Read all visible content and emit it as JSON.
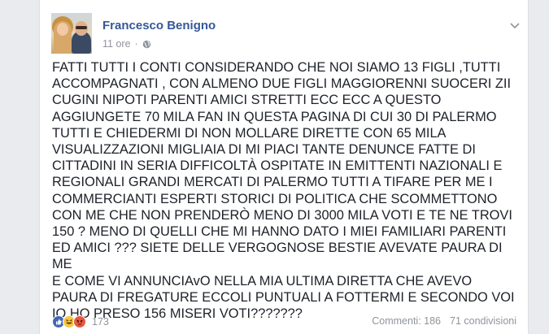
{
  "post": {
    "author": "Francesco Benigno",
    "time": "11 ore",
    "separator": "·",
    "privacy_icon": "globe-icon",
    "text": "FATTI TUTTI I CONTI CONSIDERANDO CHE NOI SIAMO 13 FIGLI ,TUTTI\nACCOMPAGNATI , CON ALMENO DUE FIGLI MAGGIORENNI SUOCERI ZII\nCUGINI NIPOTI PARENTI AMICI STRETTI ECC  ECC A QUESTO\nAGGIUNGETE 70 MILA FAN IN QUESTA PAGINA DI CUI 30 DI PALERMO\nTUTTI E CHIEDERMI DI NON MOLLARE DIRETTE CON 65 MILA\nVISUALIZZAZIONI MIGLIAIA DI MI PIACI TANTE DENUNCE FATTE DI\nCITTADINI IN SERIA DIFFICOLTÀ OSPITATE IN EMITTENTI NAZIONALI E\nREGIONALI GRANDI MERCATI DI PALERMO TUTTI A TIFARE PER ME I\nCOMMERCIANTI ESPERTI STORICI DI POLITICA CHE SCOMMETTONO\nCON ME CHE NON PRENDERÒ MENO DI 3000 MILA VOTI E TE NE TROVI\n150 ? MENO DI QUELLI CHE MI HANNO DATO I MIEI FAMILIARI PARENTI\nED AMICI ??? SIETE DELLE VERGOGNOSE BESTIE AVEVATE PAURA DI ME\nE COME VI ANNUNCIAvO NELLA MIA ULTIMA DIRETTA CHE AVEVO\nPAURA DI FREGATURE ECCOLI PUNTUALI A FOTTERMI E SECONDO VOI\nIO HO PRESO 156 MISERI VOTI???????"
  },
  "footer": {
    "reactions": [
      "like-icon",
      "haha-icon",
      "angry-icon"
    ],
    "reaction_count": "173",
    "comments": "Commenti: 186",
    "shares": "71 condivisioni"
  },
  "colors": {
    "author": "#365899",
    "meta": "#90949c",
    "text": "#1d2129",
    "background": "#e9ebee"
  }
}
